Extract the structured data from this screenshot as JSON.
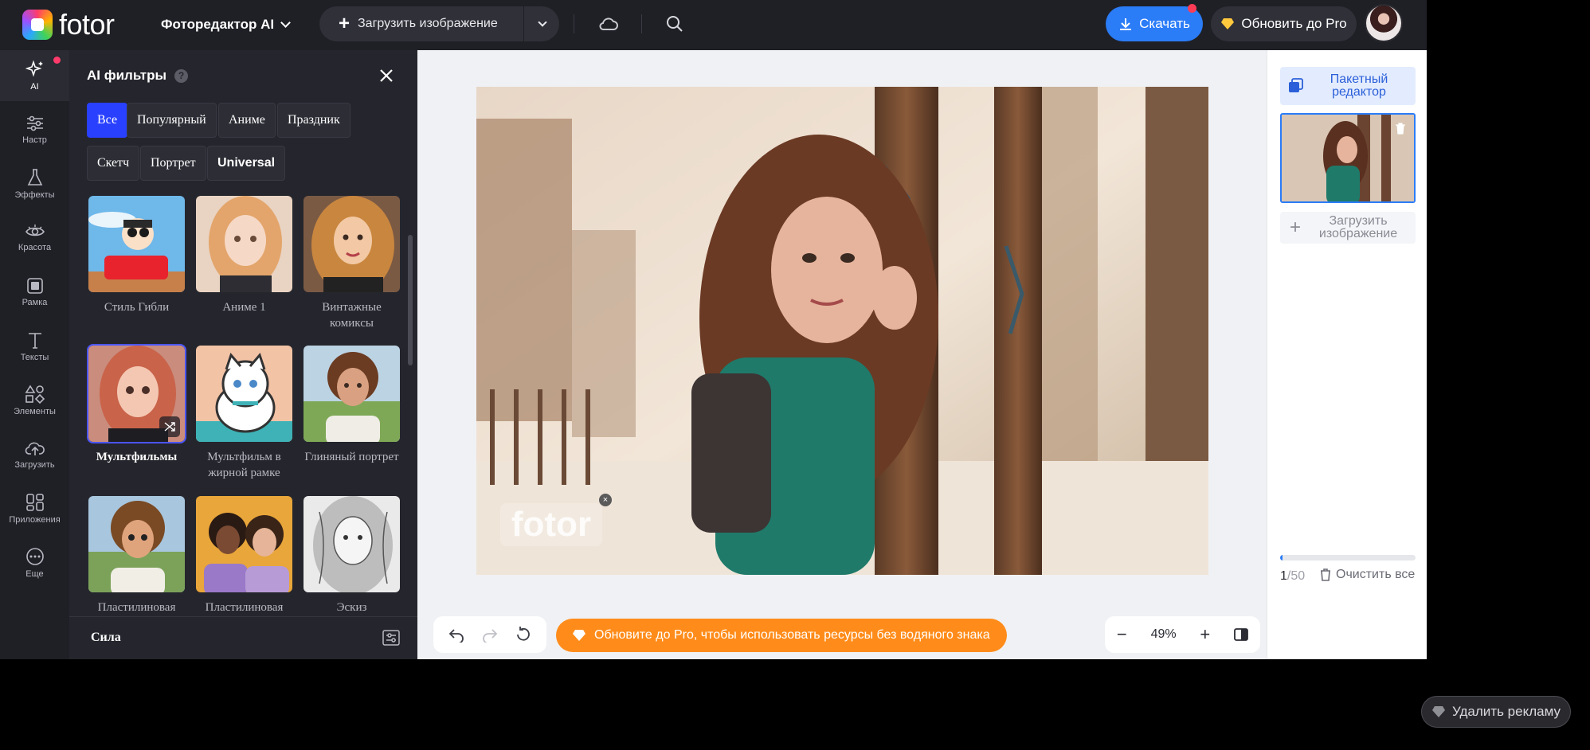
{
  "app": {
    "brand": "fotor",
    "editor_menu": "Фоторедактор AI",
    "upload_label": "Загрузить изображение",
    "download_label": "Скачать",
    "pro_label": "Обновить до Pro"
  },
  "rail": {
    "items": [
      {
        "label": "AI",
        "icon": "sparkle-icon"
      },
      {
        "label": "Настр",
        "icon": "sliders-icon"
      },
      {
        "label": "Эффекты",
        "icon": "flask-icon"
      },
      {
        "label": "Красота",
        "icon": "eye-icon"
      },
      {
        "label": "Рамка",
        "icon": "frame-icon"
      },
      {
        "label": "Тексты",
        "icon": "text-icon"
      },
      {
        "label": "Элементы",
        "icon": "elements-icon"
      },
      {
        "label": "Загрузить",
        "icon": "cloud-upload-icon"
      },
      {
        "label": "Приложения",
        "icon": "apps-icon"
      },
      {
        "label": "Еще",
        "icon": "more-icon"
      }
    ]
  },
  "panel": {
    "title": "AI фильтры",
    "help": "?",
    "chips": [
      "Все",
      "Популярный",
      "Аниме",
      "Праздник",
      "Скетч",
      "Портрет",
      "Universal"
    ],
    "filters": [
      {
        "label": "Стиль Гибли"
      },
      {
        "label": "Аниме 1"
      },
      {
        "label": "Винтажные комиксы"
      },
      {
        "label": "Мультфильмы"
      },
      {
        "label": "Мультфильм в жирной рамке"
      },
      {
        "label": "Глиняный портрет"
      },
      {
        "label": "Пластилиновая"
      },
      {
        "label": "Пластилиновая"
      },
      {
        "label": "Эскиз"
      }
    ],
    "strength_label": "Сила"
  },
  "canvas": {
    "watermark": "fotor",
    "watermark_close": "×",
    "banner": "Обновите до Pro, чтобы использовать ресурсы без водяного знака",
    "zoom": "49%",
    "zoom_minus": "−",
    "zoom_plus": "+"
  },
  "right": {
    "batch_label": "Пакетный редактор",
    "add_label": "Загрузить изображение",
    "count_current": "1",
    "count_total": "/50",
    "progress": 0.02,
    "clear_label": "Очистить все"
  },
  "ad": {
    "remove_label": "Удалить рекламу"
  },
  "colors": {
    "accent": "#2b7cf7",
    "chip_active": "#2940ff",
    "banner": "#ff8c1a",
    "dark_bg": "#1f2026",
    "panel_bg": "#25262d"
  }
}
